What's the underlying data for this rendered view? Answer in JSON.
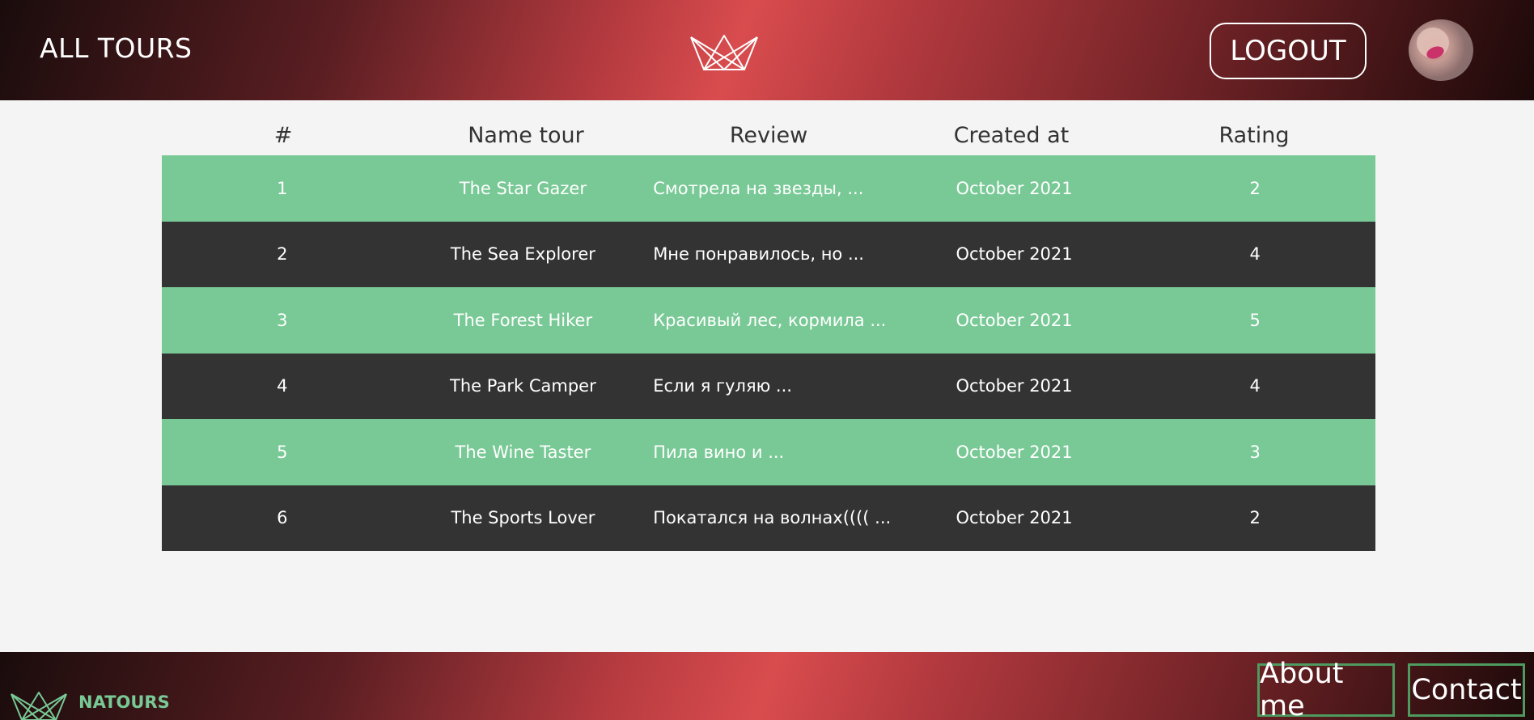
{
  "header": {
    "title": "ALL TOURS",
    "logout_label": "LOGOUT",
    "logo_icon": "crown-logo-icon",
    "avatar": "user-avatar"
  },
  "table": {
    "columns": [
      "#",
      "Name tour",
      "Review",
      "Created at",
      "Rating"
    ],
    "rows": [
      {
        "num": "1",
        "name": "The Star Gazer",
        "review": "Смотрела на звезды, ...",
        "created": "October 2021",
        "rating": "2"
      },
      {
        "num": "2",
        "name": "The Sea Explorer",
        "review": "Мне понравилось, но ...",
        "created": "October 2021",
        "rating": "4"
      },
      {
        "num": "3",
        "name": "The Forest Hiker",
        "review": "Красивый лес, кормила ...",
        "created": "October 2021",
        "rating": "5"
      },
      {
        "num": "4",
        "name": "The Park Camper",
        "review": "Если я гуляю ...",
        "created": "October 2021",
        "rating": "4"
      },
      {
        "num": "5",
        "name": "The Wine Taster",
        "review": "Пила вино и ...",
        "created": "October 2021",
        "rating": "3"
      },
      {
        "num": "6",
        "name": "The Sports Lover",
        "review": "Покатался на волнах(((( ...",
        "created": "October 2021",
        "rating": "2"
      }
    ]
  },
  "footer": {
    "brand": "NATOURS",
    "about_label": "About me",
    "contact_label": "Contact"
  },
  "colors": {
    "accent_green": "#78c995",
    "dark_row": "#333333",
    "header_red": "#d94c4e"
  }
}
